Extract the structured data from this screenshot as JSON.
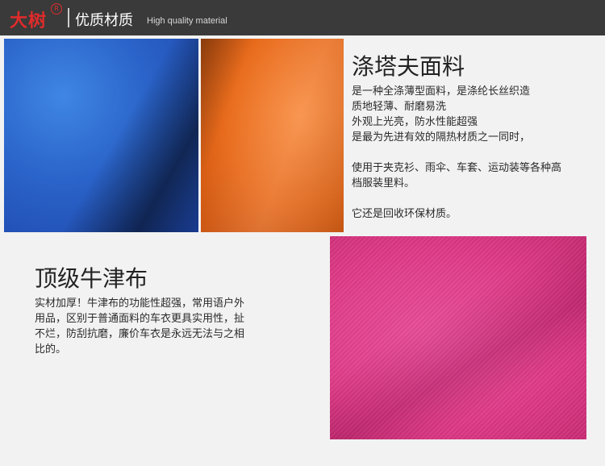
{
  "header": {
    "logo_text": "大树",
    "logo_mark": "R",
    "title": "优质材质",
    "subtitle": "High quality material",
    "colors": {
      "background": "#3a3a3a",
      "logo": "#e02b2b"
    }
  },
  "swatches": [
    {
      "name": "blue-fabric",
      "color": "#2a63c9"
    },
    {
      "name": "orange-fabric",
      "color": "#e86b1c"
    },
    {
      "name": "pink-fabric",
      "color": "#df3a87"
    }
  ],
  "product_1": {
    "title": "涤塔夫面料",
    "lines": [
      "是一种全涤薄型面料，是涤纶长丝织造",
      "质地轻薄、耐磨易洗",
      "外观上光亮，防水性能超强",
      "是最为先进有效的隔热材质之一同时，",
      "",
      "使用于夹克衫、雨伞、车套、运动装等各种高",
      "档服装里料。",
      "",
      "它还是回收环保材质。"
    ]
  },
  "product_2": {
    "title": "顶级牛津布",
    "lines": [
      "实材加厚！牛津布的功能性超强，常用语户外",
      "用品，区别于普通面料的车衣更具实用性，扯",
      "不烂，防刮抗磨，廉价车衣是永远无法与之相",
      "比的。"
    ]
  }
}
